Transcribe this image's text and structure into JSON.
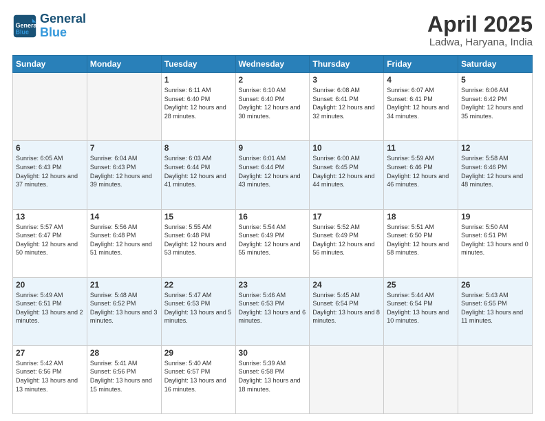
{
  "header": {
    "logo_line1": "General",
    "logo_line2": "Blue",
    "title": "April 2025",
    "subtitle": "Ladwa, Haryana, India"
  },
  "columns": [
    "Sunday",
    "Monday",
    "Tuesday",
    "Wednesday",
    "Thursday",
    "Friday",
    "Saturday"
  ],
  "weeks": [
    [
      {
        "day": "",
        "detail": ""
      },
      {
        "day": "",
        "detail": ""
      },
      {
        "day": "1",
        "detail": "Sunrise: 6:11 AM\nSunset: 6:40 PM\nDaylight: 12 hours\nand 28 minutes."
      },
      {
        "day": "2",
        "detail": "Sunrise: 6:10 AM\nSunset: 6:40 PM\nDaylight: 12 hours\nand 30 minutes."
      },
      {
        "day": "3",
        "detail": "Sunrise: 6:08 AM\nSunset: 6:41 PM\nDaylight: 12 hours\nand 32 minutes."
      },
      {
        "day": "4",
        "detail": "Sunrise: 6:07 AM\nSunset: 6:41 PM\nDaylight: 12 hours\nand 34 minutes."
      },
      {
        "day": "5",
        "detail": "Sunrise: 6:06 AM\nSunset: 6:42 PM\nDaylight: 12 hours\nand 35 minutes."
      }
    ],
    [
      {
        "day": "6",
        "detail": "Sunrise: 6:05 AM\nSunset: 6:43 PM\nDaylight: 12 hours\nand 37 minutes."
      },
      {
        "day": "7",
        "detail": "Sunrise: 6:04 AM\nSunset: 6:43 PM\nDaylight: 12 hours\nand 39 minutes."
      },
      {
        "day": "8",
        "detail": "Sunrise: 6:03 AM\nSunset: 6:44 PM\nDaylight: 12 hours\nand 41 minutes."
      },
      {
        "day": "9",
        "detail": "Sunrise: 6:01 AM\nSunset: 6:44 PM\nDaylight: 12 hours\nand 43 minutes."
      },
      {
        "day": "10",
        "detail": "Sunrise: 6:00 AM\nSunset: 6:45 PM\nDaylight: 12 hours\nand 44 minutes."
      },
      {
        "day": "11",
        "detail": "Sunrise: 5:59 AM\nSunset: 6:46 PM\nDaylight: 12 hours\nand 46 minutes."
      },
      {
        "day": "12",
        "detail": "Sunrise: 5:58 AM\nSunset: 6:46 PM\nDaylight: 12 hours\nand 48 minutes."
      }
    ],
    [
      {
        "day": "13",
        "detail": "Sunrise: 5:57 AM\nSunset: 6:47 PM\nDaylight: 12 hours\nand 50 minutes."
      },
      {
        "day": "14",
        "detail": "Sunrise: 5:56 AM\nSunset: 6:48 PM\nDaylight: 12 hours\nand 51 minutes."
      },
      {
        "day": "15",
        "detail": "Sunrise: 5:55 AM\nSunset: 6:48 PM\nDaylight: 12 hours\nand 53 minutes."
      },
      {
        "day": "16",
        "detail": "Sunrise: 5:54 AM\nSunset: 6:49 PM\nDaylight: 12 hours\nand 55 minutes."
      },
      {
        "day": "17",
        "detail": "Sunrise: 5:52 AM\nSunset: 6:49 PM\nDaylight: 12 hours\nand 56 minutes."
      },
      {
        "day": "18",
        "detail": "Sunrise: 5:51 AM\nSunset: 6:50 PM\nDaylight: 12 hours\nand 58 minutes."
      },
      {
        "day": "19",
        "detail": "Sunrise: 5:50 AM\nSunset: 6:51 PM\nDaylight: 13 hours\nand 0 minutes."
      }
    ],
    [
      {
        "day": "20",
        "detail": "Sunrise: 5:49 AM\nSunset: 6:51 PM\nDaylight: 13 hours\nand 2 minutes."
      },
      {
        "day": "21",
        "detail": "Sunrise: 5:48 AM\nSunset: 6:52 PM\nDaylight: 13 hours\nand 3 minutes."
      },
      {
        "day": "22",
        "detail": "Sunrise: 5:47 AM\nSunset: 6:53 PM\nDaylight: 13 hours\nand 5 minutes."
      },
      {
        "day": "23",
        "detail": "Sunrise: 5:46 AM\nSunset: 6:53 PM\nDaylight: 13 hours\nand 6 minutes."
      },
      {
        "day": "24",
        "detail": "Sunrise: 5:45 AM\nSunset: 6:54 PM\nDaylight: 13 hours\nand 8 minutes."
      },
      {
        "day": "25",
        "detail": "Sunrise: 5:44 AM\nSunset: 6:54 PM\nDaylight: 13 hours\nand 10 minutes."
      },
      {
        "day": "26",
        "detail": "Sunrise: 5:43 AM\nSunset: 6:55 PM\nDaylight: 13 hours\nand 11 minutes."
      }
    ],
    [
      {
        "day": "27",
        "detail": "Sunrise: 5:42 AM\nSunset: 6:56 PM\nDaylight: 13 hours\nand 13 minutes."
      },
      {
        "day": "28",
        "detail": "Sunrise: 5:41 AM\nSunset: 6:56 PM\nDaylight: 13 hours\nand 15 minutes."
      },
      {
        "day": "29",
        "detail": "Sunrise: 5:40 AM\nSunset: 6:57 PM\nDaylight: 13 hours\nand 16 minutes."
      },
      {
        "day": "30",
        "detail": "Sunrise: 5:39 AM\nSunset: 6:58 PM\nDaylight: 13 hours\nand 18 minutes."
      },
      {
        "day": "",
        "detail": ""
      },
      {
        "day": "",
        "detail": ""
      },
      {
        "day": "",
        "detail": ""
      }
    ]
  ]
}
